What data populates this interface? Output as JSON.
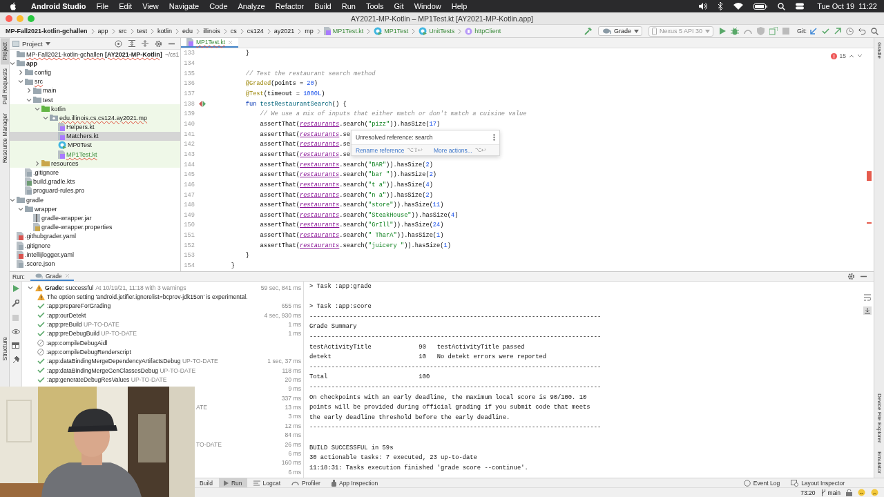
{
  "menubar": {
    "app": "Android Studio",
    "menus": [
      "File",
      "Edit",
      "View",
      "Navigate",
      "Code",
      "Analyze",
      "Refactor",
      "Build",
      "Run",
      "Tools",
      "Git",
      "Window",
      "Help"
    ],
    "clock": "Tue Oct 19  11:22"
  },
  "window": {
    "title": "AY2021-MP-Kotlin – MP1Test.kt [AY2021-MP-Kotlin.app]"
  },
  "breadcrumbs": [
    {
      "label": "MP-Fall2021-kotlin-gchallen",
      "kind": "project"
    },
    {
      "label": "app",
      "kind": "folder"
    },
    {
      "label": "src",
      "kind": "folder"
    },
    {
      "label": "test",
      "kind": "folder"
    },
    {
      "label": "kotlin",
      "kind": "folder"
    },
    {
      "label": "edu",
      "kind": "folder"
    },
    {
      "label": "illinois",
      "kind": "folder"
    },
    {
      "label": "cs",
      "kind": "folder"
    },
    {
      "label": "cs124",
      "kind": "folder"
    },
    {
      "label": "ay2021",
      "kind": "folder"
    },
    {
      "label": "mp",
      "kind": "folder"
    },
    {
      "label": "MP1Test.kt",
      "kind": "kotlin-file"
    },
    {
      "label": "MP1Test",
      "kind": "class"
    },
    {
      "label": "UnitTests",
      "kind": "class"
    },
    {
      "label": "httpClient",
      "kind": "property"
    }
  ],
  "toolbar": {
    "run_config": "Grade",
    "device": "Nexus 5 API 30",
    "vcs_label": "Git:"
  },
  "left_stripe": [
    {
      "label": "Project",
      "selected": true
    },
    {
      "label": "Pull Requests",
      "selected": false
    },
    {
      "label": "Resource Manager",
      "selected": false
    }
  ],
  "structure_tab": {
    "label": "Structure"
  },
  "project_panel": {
    "title": "Project",
    "tree": [
      {
        "label": "MP-Fall2021-kotlin-gchallen **[AY2021-MP-Kotlin]**",
        "path": "~/cs1",
        "kind": "project",
        "selected": false,
        "error": true,
        "children": [
          {
            "label": "app",
            "kind": "module",
            "expanded": true,
            "selected": false,
            "children": [
              {
                "label": "config",
                "kind": "folder",
                "expanded": false,
                "selected": false
              },
              {
                "label": "src",
                "kind": "folder",
                "expanded": true,
                "selected": false,
                "error": true,
                "children": [
                  {
                    "label": "main",
                    "kind": "folder",
                    "expanded": false,
                    "selected": false
                  },
                  {
                    "label": "test",
                    "kind": "folder",
                    "expanded": true,
                    "selected": false,
                    "highlight_children": true,
                    "children": [
                      {
                        "label": "kotlin",
                        "kind": "test-folder",
                        "expanded": true,
                        "selected": false,
                        "children": [
                          {
                            "label": "edu.illinois.cs.cs124.ay2021.mp",
                            "kind": "package",
                            "expanded": true,
                            "selected": false,
                            "error": true,
                            "children": [
                              {
                                "label": "Helpers.kt",
                                "kind": "kotlin-file",
                                "selected": false
                              },
                              {
                                "label": "Matchers.kt",
                                "kind": "kotlin-file",
                                "selected": true
                              },
                              {
                                "label": "MP0Test",
                                "kind": "class",
                                "selected": false
                              },
                              {
                                "label": "MP1Test.kt",
                                "kind": "kotlin-file",
                                "selected": false,
                                "error": true,
                                "modified": true
                              }
                            ]
                          }
                        ]
                      },
                      {
                        "label": "resources",
                        "kind": "resources",
                        "expanded": false,
                        "selected": false
                      }
                    ]
                  }
                ]
              },
              {
                "label": ".gitignore",
                "kind": "text",
                "selected": false
              },
              {
                "label": "build.gradle.kts",
                "kind": "gradle",
                "selected": false
              },
              {
                "label": "proguard-rules.pro",
                "kind": "text",
                "selected": false
              }
            ]
          },
          {
            "label": "gradle",
            "kind": "folder",
            "expanded": true,
            "selected": false,
            "children": [
              {
                "label": "wrapper",
                "kind": "folder",
                "expanded": true,
                "selected": false,
                "children": [
                  {
                    "label": "gradle-wrapper.jar",
                    "kind": "jar",
                    "selected": false
                  },
                  {
                    "label": "gradle-wrapper.properties",
                    "kind": "properties",
                    "selected": false
                  }
                ]
              }
            ]
          },
          {
            "label": ".githubgrader.yaml",
            "kind": "yaml",
            "selected": false
          },
          {
            "label": ".gitignore",
            "kind": "text",
            "selected": false
          },
          {
            "label": ".intellijlogger.yaml",
            "kind": "yaml",
            "selected": false
          },
          {
            "label": ".score.json",
            "kind": "text",
            "selected": false
          }
        ]
      }
    ]
  },
  "editor": {
    "tabs": [
      {
        "label": "MP1Test.kt",
        "selected": true
      }
    ],
    "error_count": "15",
    "lines": [
      {
        "number": "133",
        "tokens": [
          {
            "text": "        }",
            "kind": "plain"
          }
        ]
      },
      {
        "number": "134"
      },
      {
        "number": "135",
        "tokens": [
          {
            "text": "        // Test the restaurant search method",
            "kind": "comment"
          }
        ]
      },
      {
        "number": "136",
        "tokens": [
          {
            "text": "        @Graded",
            "kind": "annotation"
          },
          {
            "text": "(points = ",
            "kind": "plain"
          },
          {
            "text": "20",
            "kind": "number"
          },
          {
            "text": ")",
            "kind": "plain"
          }
        ]
      },
      {
        "number": "137",
        "tokens": [
          {
            "text": "        @Test",
            "kind": "annotation"
          },
          {
            "text": "(timeout = ",
            "kind": "plain"
          },
          {
            "text": "1000L",
            "kind": "number"
          },
          {
            "text": ")",
            "kind": "plain"
          }
        ]
      },
      {
        "number": "138",
        "run_marker": true,
        "tokens": [
          {
            "text": "        fun ",
            "kind": "keyword"
          },
          {
            "text": "testRestaurantSearch",
            "kind": "function"
          },
          {
            "text": "() {",
            "kind": "plain"
          }
        ]
      },
      {
        "number": "139",
        "tokens": [
          {
            "text": "            // We use a mix of inputs that either match or don't match a cuisine value",
            "kind": "comment"
          }
        ]
      },
      {
        "number": "140",
        "tokens": [
          {
            "text": "            assertThat(",
            "kind": "plain"
          },
          {
            "text": "restaurants",
            "kind": "property"
          },
          {
            "text": ".search(",
            "kind": "plain"
          },
          {
            "text": "\"pizz\"",
            "kind": "string"
          },
          {
            "text": ")).hasSize(",
            "kind": "plain"
          },
          {
            "text": "17",
            "kind": "number"
          },
          {
            "text": ")",
            "kind": "plain"
          }
        ]
      },
      {
        "number": "141",
        "tokens": [
          {
            "text": "            assertThat(",
            "kind": "plain"
          },
          {
            "text": "restaurants",
            "kind": "property"
          },
          {
            "text": ".se",
            "kind": "plain"
          }
        ]
      },
      {
        "number": "142",
        "tokens": [
          {
            "text": "            assertThat(",
            "kind": "plain"
          },
          {
            "text": "restaurants",
            "kind": "property"
          },
          {
            "text": ".se",
            "kind": "plain"
          }
        ]
      },
      {
        "number": "143",
        "tokens": [
          {
            "text": "            assertThat(",
            "kind": "plain"
          },
          {
            "text": "restaurants",
            "kind": "property"
          },
          {
            "text": ".se",
            "kind": "plain"
          }
        ]
      },
      {
        "number": "144",
        "tokens": [
          {
            "text": "            assertThat(",
            "kind": "plain"
          },
          {
            "text": "restaurants",
            "kind": "property"
          },
          {
            "text": ".search(",
            "kind": "plain"
          },
          {
            "text": "\"BAR\"",
            "kind": "string"
          },
          {
            "text": ")).hasSize(",
            "kind": "plain"
          },
          {
            "text": "2",
            "kind": "number"
          },
          {
            "text": ")",
            "kind": "plain"
          }
        ]
      },
      {
        "number": "145",
        "tokens": [
          {
            "text": "            assertThat(",
            "kind": "plain"
          },
          {
            "text": "restaurants",
            "kind": "property"
          },
          {
            "text": ".search(",
            "kind": "plain"
          },
          {
            "text": "\"bar \"",
            "kind": "string"
          },
          {
            "text": ")).hasSize(",
            "kind": "plain"
          },
          {
            "text": "2",
            "kind": "number"
          },
          {
            "text": ")",
            "kind": "plain"
          }
        ]
      },
      {
        "number": "146",
        "tokens": [
          {
            "text": "            assertThat(",
            "kind": "plain"
          },
          {
            "text": "restaurants",
            "kind": "property"
          },
          {
            "text": ".search(",
            "kind": "plain"
          },
          {
            "text": "\"t a\"",
            "kind": "string"
          },
          {
            "text": ")).hasSize(",
            "kind": "plain"
          },
          {
            "text": "4",
            "kind": "number"
          },
          {
            "text": ")",
            "kind": "plain"
          }
        ]
      },
      {
        "number": "147",
        "tokens": [
          {
            "text": "            assertThat(",
            "kind": "plain"
          },
          {
            "text": "restaurants",
            "kind": "property"
          },
          {
            "text": ".search(",
            "kind": "plain"
          },
          {
            "text": "\"n a\"",
            "kind": "string"
          },
          {
            "text": ")).hasSize(",
            "kind": "plain"
          },
          {
            "text": "2",
            "kind": "number"
          },
          {
            "text": ")",
            "kind": "plain"
          }
        ]
      },
      {
        "number": "148",
        "tokens": [
          {
            "text": "            assertThat(",
            "kind": "plain"
          },
          {
            "text": "restaurants",
            "kind": "property"
          },
          {
            "text": ".search(",
            "kind": "plain"
          },
          {
            "text": "\"store\"",
            "kind": "string"
          },
          {
            "text": ")).hasSize(",
            "kind": "plain"
          },
          {
            "text": "11",
            "kind": "number"
          },
          {
            "text": ")",
            "kind": "plain"
          }
        ]
      },
      {
        "number": "149",
        "tokens": [
          {
            "text": "            assertThat(",
            "kind": "plain"
          },
          {
            "text": "restaurants",
            "kind": "property"
          },
          {
            "text": ".search(",
            "kind": "plain"
          },
          {
            "text": "\"SteakHouse\"",
            "kind": "string"
          },
          {
            "text": ")).hasSize(",
            "kind": "plain"
          },
          {
            "text": "4",
            "kind": "number"
          },
          {
            "text": ")",
            "kind": "plain"
          }
        ]
      },
      {
        "number": "150",
        "tokens": [
          {
            "text": "            assertThat(",
            "kind": "plain"
          },
          {
            "text": "restaurants",
            "kind": "property"
          },
          {
            "text": ".search(",
            "kind": "plain"
          },
          {
            "text": "\"GrIll\"",
            "kind": "string"
          },
          {
            "text": ")).hasSize(",
            "kind": "plain"
          },
          {
            "text": "24",
            "kind": "number"
          },
          {
            "text": ")",
            "kind": "plain"
          }
        ]
      },
      {
        "number": "151",
        "tokens": [
          {
            "text": "            assertThat(",
            "kind": "plain"
          },
          {
            "text": "restaurants",
            "kind": "property"
          },
          {
            "text": ".search(",
            "kind": "plain"
          },
          {
            "text": "\" TharA\"",
            "kind": "string"
          },
          {
            "text": ")).hasSize(",
            "kind": "plain"
          },
          {
            "text": "1",
            "kind": "number"
          },
          {
            "text": ")",
            "kind": "plain"
          }
        ]
      },
      {
        "number": "152",
        "tokens": [
          {
            "text": "            assertThat(",
            "kind": "plain"
          },
          {
            "text": "restaurants",
            "kind": "property"
          },
          {
            "text": ".search(",
            "kind": "plain"
          },
          {
            "text": "\"juicery \"",
            "kind": "string"
          },
          {
            "text": ")).hasSize(",
            "kind": "plain"
          },
          {
            "text": "1",
            "kind": "number"
          },
          {
            "text": ")",
            "kind": "plain"
          }
        ]
      },
      {
        "number": "153",
        "tokens": [
          {
            "text": "        }",
            "kind": "plain"
          }
        ]
      },
      {
        "number": "154",
        "tokens": [
          {
            "text": "    }",
            "kind": "plain"
          }
        ]
      }
    ],
    "popup": {
      "message": "Unresolved reference: search",
      "actions": [
        {
          "label": "Rename reference",
          "shortcut": "⌥⇧↩"
        },
        {
          "label": "More actions...",
          "shortcut": "⌥↩"
        }
      ]
    }
  },
  "right_stripe_top": [
    {
      "label": "Gradle",
      "selected": false
    }
  ],
  "right_stripe_bottom": [
    {
      "label": "Device File Explorer",
      "selected": false
    },
    {
      "label": "Emulator",
      "selected": false
    }
  ],
  "run_panel": {
    "label": "Run:",
    "tabs": [
      {
        "label": "Grade",
        "selected": true
      }
    ],
    "build": {
      "status": "**Grade:** successful",
      "detail": "At 10/19/21, 11:18 with 3 warnings",
      "time": "59 sec, 841 ms",
      "expanded": true,
      "tasks": [
        {
          "kind": "warning",
          "label": "The option setting 'android.jetifier.ignorelist=bcprov-jdk15on' is experimental."
        },
        {
          "kind": "success",
          "label": ":app:prepareForGrading",
          "time": "655 ms"
        },
        {
          "kind": "success",
          "label": ":app:ourDetekt",
          "time": "4 sec, 930 ms"
        },
        {
          "kind": "success",
          "label": ":app:preBuild",
          "note": "UP-TO-DATE",
          "time": "1 ms"
        },
        {
          "kind": "success",
          "label": ":app:preDebugBuild",
          "note": "UP-TO-DATE",
          "time": "1 ms"
        },
        {
          "kind": "skipped",
          "label": ":app:compileDebugAidl"
        },
        {
          "kind": "skipped",
          "label": ":app:compileDebugRenderscript"
        },
        {
          "kind": "success",
          "label": ":app:dataBindingMergeDependencyArtifactsDebug",
          "note": "UP-TO-DATE",
          "time": "1 sec, 37 ms"
        },
        {
          "kind": "success",
          "label": ":app:dataBindingMergeGenClassesDebug",
          "note": "UP-TO-DATE",
          "time": "118 ms"
        },
        {
          "kind": "success",
          "label": ":app:generateDebugResValues",
          "note": "UP-TO-DATE",
          "time": "20 ms"
        },
        {
          "kind": "covered",
          "time": "9 ms"
        },
        {
          "kind": "covered",
          "time": "337 ms"
        },
        {
          "kind": "covered",
          "fragment": "ATE",
          "time": "13 ms"
        },
        {
          "kind": "covered",
          "time": "3 ms"
        },
        {
          "kind": "covered",
          "time": "12 ms"
        },
        {
          "kind": "covered",
          "time": "84 ms"
        },
        {
          "kind": "covered",
          "fragment": "TO-DATE",
          "time": "26 ms"
        },
        {
          "kind": "covered",
          "time": "6 ms"
        },
        {
          "kind": "covered",
          "time": "160 ms"
        },
        {
          "kind": "covered",
          "time": "6 ms"
        }
      ]
    },
    "console": [
      {
        "kind": "text",
        "text": "> Task :app:grade"
      },
      {
        "kind": "blank"
      },
      {
        "kind": "text",
        "text": "> Task :app:score"
      },
      {
        "kind": "text",
        "text": "--------------------------------------------------------------------------------"
      },
      {
        "kind": "text",
        "text": "Grade Summary"
      },
      {
        "kind": "text",
        "text": "--------------------------------------------------------------------------------"
      },
      {
        "kind": "text",
        "text": "testActivityTitle             90   testActivityTitle passed"
      },
      {
        "kind": "text",
        "text": "detekt                        10   No detekt errors were reported"
      },
      {
        "kind": "text",
        "text": "--------------------------------------------------------------------------------"
      },
      {
        "kind": "text",
        "text": "Total                         100"
      },
      {
        "kind": "text",
        "text": "--------------------------------------------------------------------------------"
      },
      {
        "kind": "text",
        "text": "On checkpoints with an early deadline, the maximum local score is 90/100. 10"
      },
      {
        "kind": "text",
        "text": "points will be provided during official grading if you submit code that meets"
      },
      {
        "kind": "text",
        "text": "the early deadline threshold before the early deadline."
      },
      {
        "kind": "text",
        "text": "--------------------------------------------------------------------------------"
      },
      {
        "kind": "blank"
      },
      {
        "kind": "text",
        "text": "BUILD SUCCESSFUL in 59s"
      },
      {
        "kind": "text",
        "text": "30 actionable tasks: 7 executed, 23 up-to-date"
      },
      {
        "kind": "text",
        "text": "11:18:31: Tasks execution finished 'grade score --continue'."
      }
    ]
  },
  "tool_windows": [
    {
      "label": "Build",
      "kind": "plain",
      "selected": false
    },
    {
      "label": "Run",
      "kind": "run",
      "selected": true
    },
    {
      "label": "Logcat",
      "kind": "list",
      "selected": false
    },
    {
      "label": "Profiler",
      "kind": "gauge",
      "selected": false
    },
    {
      "label": "App Inspection",
      "kind": "inspect",
      "selected": false
    }
  ],
  "tool_windows_right": [
    {
      "label": "Event Log",
      "kind": "balloon"
    },
    {
      "label": "Layout Inspector",
      "kind": "layout"
    }
  ],
  "status_bar": {
    "position": "73:20",
    "branch": "main"
  }
}
